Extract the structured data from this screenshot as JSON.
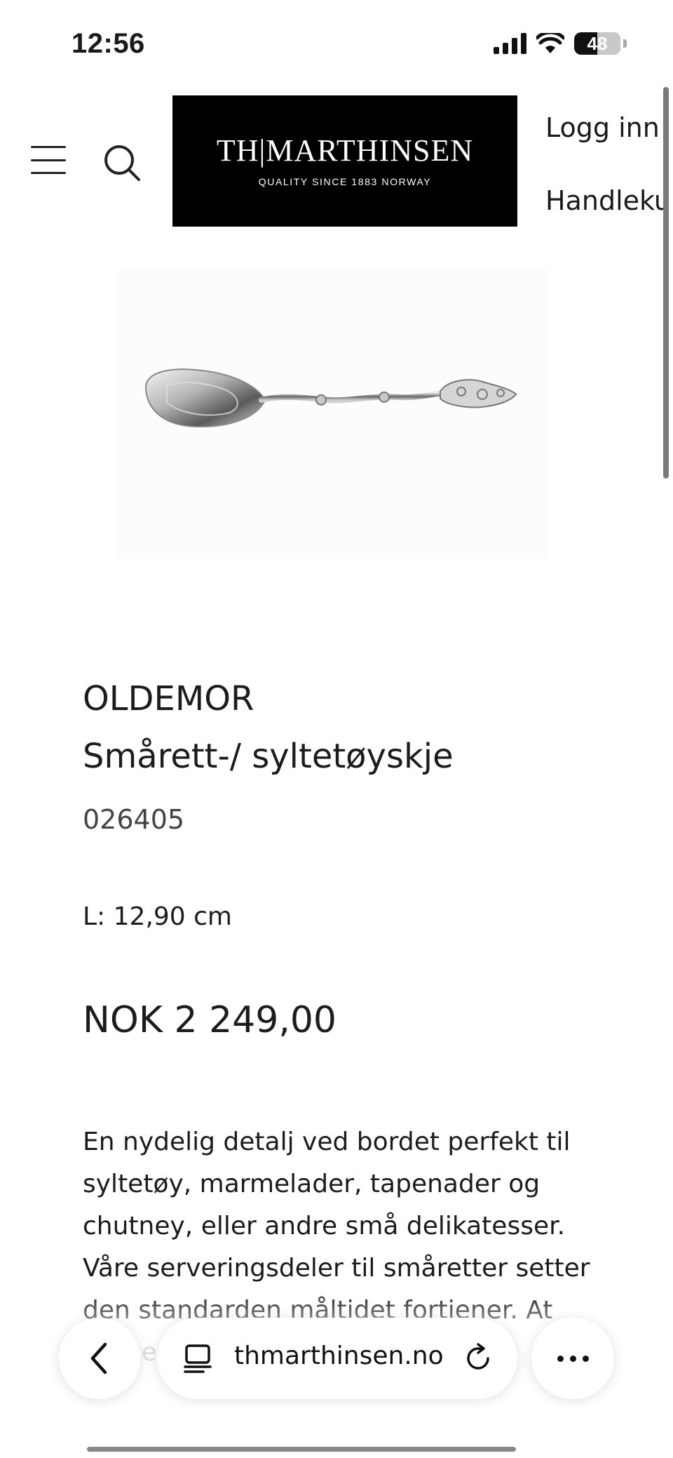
{
  "status_bar": {
    "time": "12:56",
    "battery_level": "48"
  },
  "header": {
    "logo_main": "TH|MARTHINSEN",
    "logo_sub": "QUALITY SINCE 1883   NORWAY",
    "login_label": "Logg inn",
    "cart_label": "Handlekurv"
  },
  "product": {
    "brand": "OLDEMOR",
    "name": "Smårett-/ syltetøyskje",
    "sku": "026405",
    "length": "L: 12,90 cm",
    "price": "NOK 2 249,00",
    "description": "En nydelig detalj ved bordet perfekt til syltetøy, marmelader, tapenader og chutney, eller andre små delikatesser. Våre serveringsdeler til småretter setter den standarden måltidet fortjener. At sølv er"
  },
  "browser": {
    "url": "thmarthinsen.no"
  },
  "icons": {
    "menu": "hamburger-icon",
    "search": "search-icon",
    "back": "chevron-left-icon",
    "tabs": "tabs-icon",
    "reload": "reload-icon",
    "more": "more-icon"
  }
}
